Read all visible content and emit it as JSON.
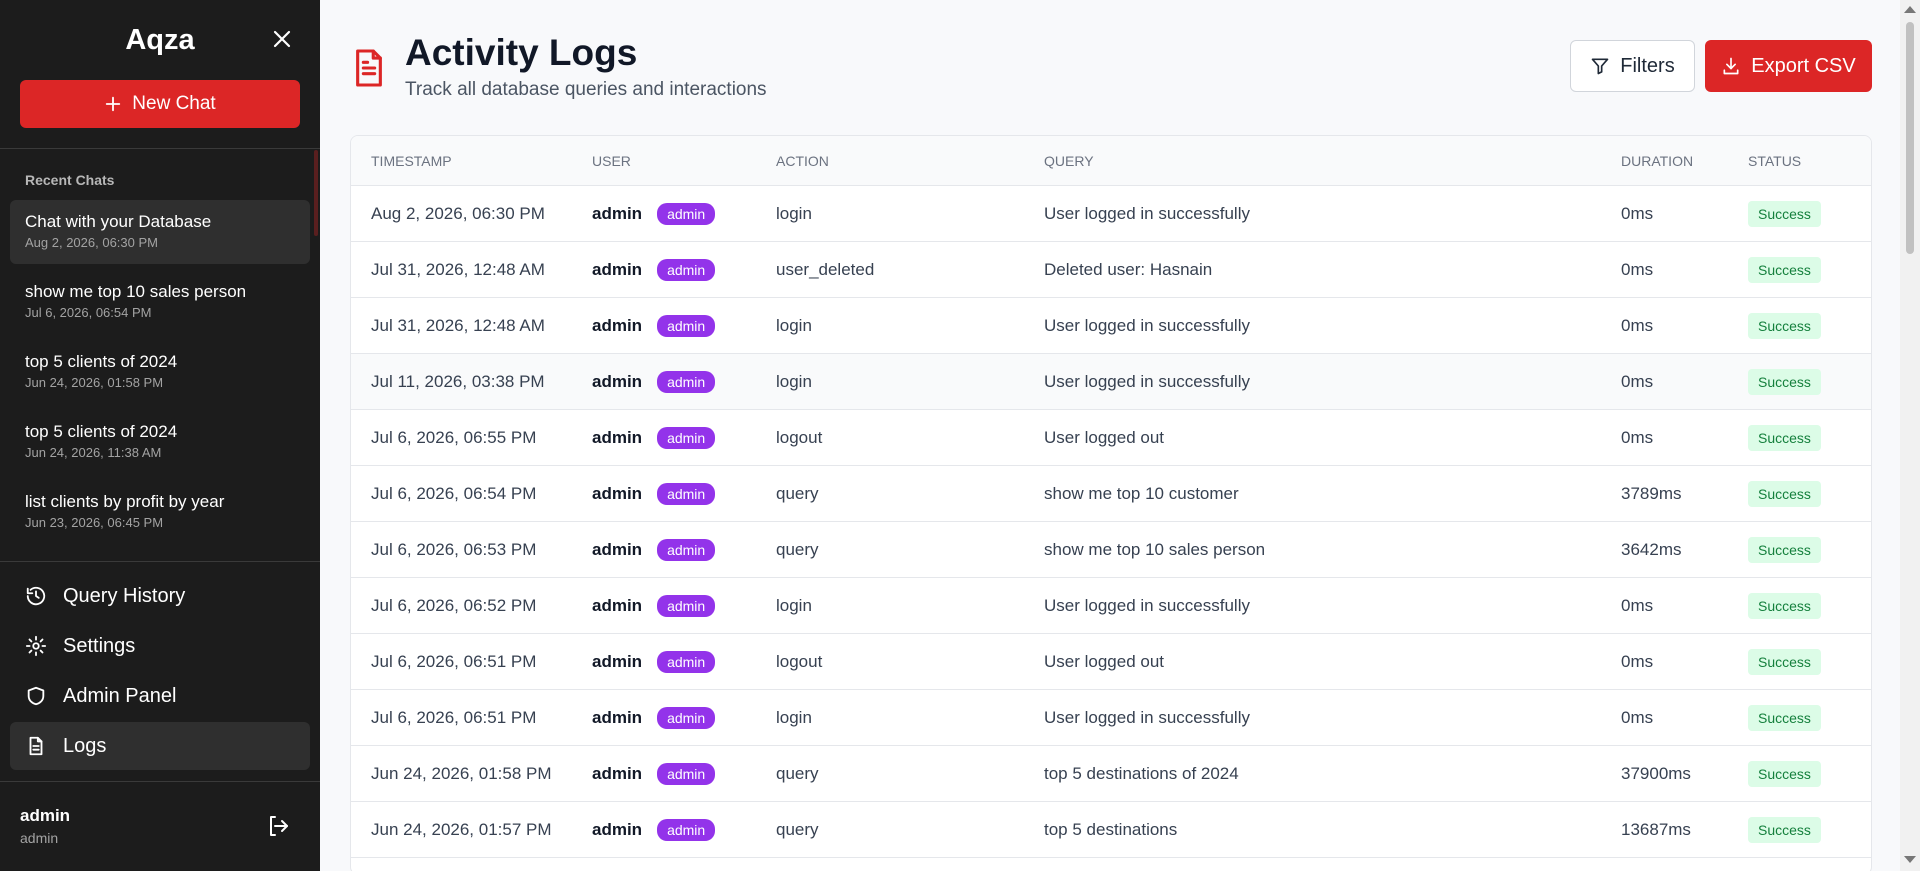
{
  "sidebar": {
    "app_title": "Aqza",
    "new_chat_label": "New Chat",
    "recent_title": "Recent Chats",
    "chats": [
      {
        "title": "Chat with your Database",
        "date": "Aug 2, 2026, 06:30 PM"
      },
      {
        "title": "show me top 10 sales person",
        "date": "Jul 6, 2026, 06:54 PM"
      },
      {
        "title": "top 5 clients of 2024",
        "date": "Jun 24, 2026, 01:58 PM"
      },
      {
        "title": "top 5 clients of 2024",
        "date": "Jun 24, 2026, 11:38 AM"
      },
      {
        "title": "list clients by profit by year",
        "date": "Jun 23, 2026, 06:45 PM"
      }
    ],
    "nav": [
      {
        "label": "Query History",
        "icon": "history-icon"
      },
      {
        "label": "Settings",
        "icon": "gear-icon"
      },
      {
        "label": "Admin Panel",
        "icon": "shield-icon"
      },
      {
        "label": "Logs",
        "icon": "document-icon"
      }
    ],
    "user": {
      "name": "admin",
      "role": "admin"
    }
  },
  "header": {
    "title": "Activity Logs",
    "subtitle": "Track all database queries and interactions",
    "filters_label": "Filters",
    "export_label": "Export CSV"
  },
  "table": {
    "columns": [
      "TIMESTAMP",
      "USER",
      "ACTION",
      "QUERY",
      "DURATION",
      "STATUS"
    ],
    "rows": [
      {
        "timestamp": "Aug 2, 2026, 06:30 PM",
        "user": "admin",
        "role": "admin",
        "action": "login",
        "query": "User logged in successfully",
        "duration": "0ms",
        "status": "Success"
      },
      {
        "timestamp": "Jul 31, 2026, 12:48 AM",
        "user": "admin",
        "role": "admin",
        "action": "user_deleted",
        "query": "Deleted user: Hasnain",
        "duration": "0ms",
        "status": "Success"
      },
      {
        "timestamp": "Jul 31, 2026, 12:48 AM",
        "user": "admin",
        "role": "admin",
        "action": "login",
        "query": "User logged in successfully",
        "duration": "0ms",
        "status": "Success"
      },
      {
        "timestamp": "Jul 11, 2026, 03:38 PM",
        "user": "admin",
        "role": "admin",
        "action": "login",
        "query": "User logged in successfully",
        "duration": "0ms",
        "status": "Success"
      },
      {
        "timestamp": "Jul 6, 2026, 06:55 PM",
        "user": "admin",
        "role": "admin",
        "action": "logout",
        "query": "User logged out",
        "duration": "0ms",
        "status": "Success"
      },
      {
        "timestamp": "Jul 6, 2026, 06:54 PM",
        "user": "admin",
        "role": "admin",
        "action": "query",
        "query": "show me top 10 customer",
        "duration": "3789ms",
        "status": "Success"
      },
      {
        "timestamp": "Jul 6, 2026, 06:53 PM",
        "user": "admin",
        "role": "admin",
        "action": "query",
        "query": "show me top 10 sales person",
        "duration": "3642ms",
        "status": "Success"
      },
      {
        "timestamp": "Jul 6, 2026, 06:52 PM",
        "user": "admin",
        "role": "admin",
        "action": "login",
        "query": "User logged in successfully",
        "duration": "0ms",
        "status": "Success"
      },
      {
        "timestamp": "Jul 6, 2026, 06:51 PM",
        "user": "admin",
        "role": "admin",
        "action": "logout",
        "query": "User logged out",
        "duration": "0ms",
        "status": "Success"
      },
      {
        "timestamp": "Jul 6, 2026, 06:51 PM",
        "user": "admin",
        "role": "admin",
        "action": "login",
        "query": "User logged in successfully",
        "duration": "0ms",
        "status": "Success"
      },
      {
        "timestamp": "Jun 24, 2026, 01:58 PM",
        "user": "admin",
        "role": "admin",
        "action": "query",
        "query": "top 5 destinations of 2024",
        "duration": "37900ms",
        "status": "Success"
      },
      {
        "timestamp": "Jun 24, 2026, 01:57 PM",
        "user": "admin",
        "role": "admin",
        "action": "query",
        "query": "top 5 destinations",
        "duration": "13687ms",
        "status": "Success"
      }
    ]
  },
  "colors": {
    "accent": "#dc2626",
    "sidebar_bg": "#1c1c1c",
    "role_badge": "#9333ea",
    "success_bg": "#dcfce7",
    "success_text": "#15803d"
  }
}
